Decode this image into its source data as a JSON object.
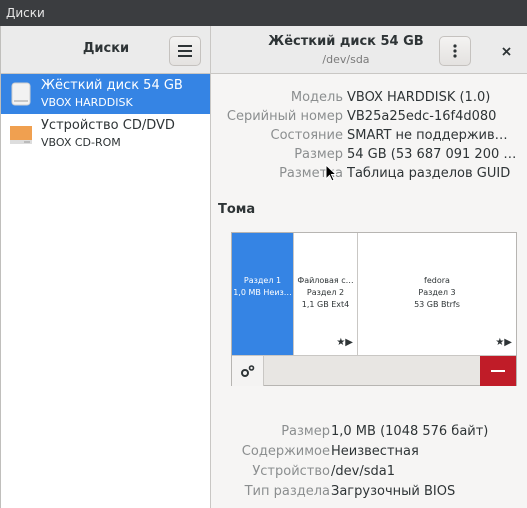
{
  "titlebar": {
    "title": "Диски"
  },
  "header": {
    "left_title": "Диски",
    "disk_title": "Жёсткий диск 54 GB",
    "disk_subtitle": "/dev/sda"
  },
  "sidebar": {
    "items": [
      {
        "name": "Жёсткий диск 54 GB",
        "sub": "VBOX HARDDISK",
        "icon": "hard-disk-icon",
        "selected": true
      },
      {
        "name": "Устройство CD/DVD",
        "sub": "VBOX CD-ROM",
        "icon": "optical-drive-icon",
        "selected": false
      }
    ]
  },
  "disk_props": {
    "model_label": "Модель",
    "model_value": "VBOX HARDDISK (1.0)",
    "serial_label": "Серийный номер",
    "serial_value": "VB25a25edc-16f4d080",
    "state_label": "Состояние",
    "state_value": "SMART не поддержив…",
    "size_label": "Размер",
    "size_value": "54 GB (53 687 091 200 …",
    "partitioning_label": "Разметка",
    "partitioning_value": "Таблица разделов GUID"
  },
  "volumes": {
    "section_title": "Тома",
    "parts": [
      {
        "line1": "Раздел 1",
        "line2": "1,0 MB Неиз…",
        "line3": "",
        "selected": true
      },
      {
        "line1": "Файловая с…",
        "line2": "Раздел 2",
        "line3": "1,1 GB Ext4",
        "selected": false
      },
      {
        "line1": "fedora",
        "line2": "Раздел 3",
        "line3": "53 GB Btrfs",
        "selected": false
      }
    ],
    "marks": "★▶"
  },
  "partition_props": {
    "size_label": "Размер",
    "size_value": "1,0 MB (1048 576 байт)",
    "content_label": "Содержимое",
    "content_value": "Неизвестная",
    "device_label": "Устройство",
    "device_value": "/dev/sda1",
    "type_label": "Тип раздела",
    "type_value": "Загрузочный BIOS"
  },
  "colors": {
    "accent": "#3584e4",
    "danger": "#c01c28",
    "cd_icon": "#f0a050"
  }
}
